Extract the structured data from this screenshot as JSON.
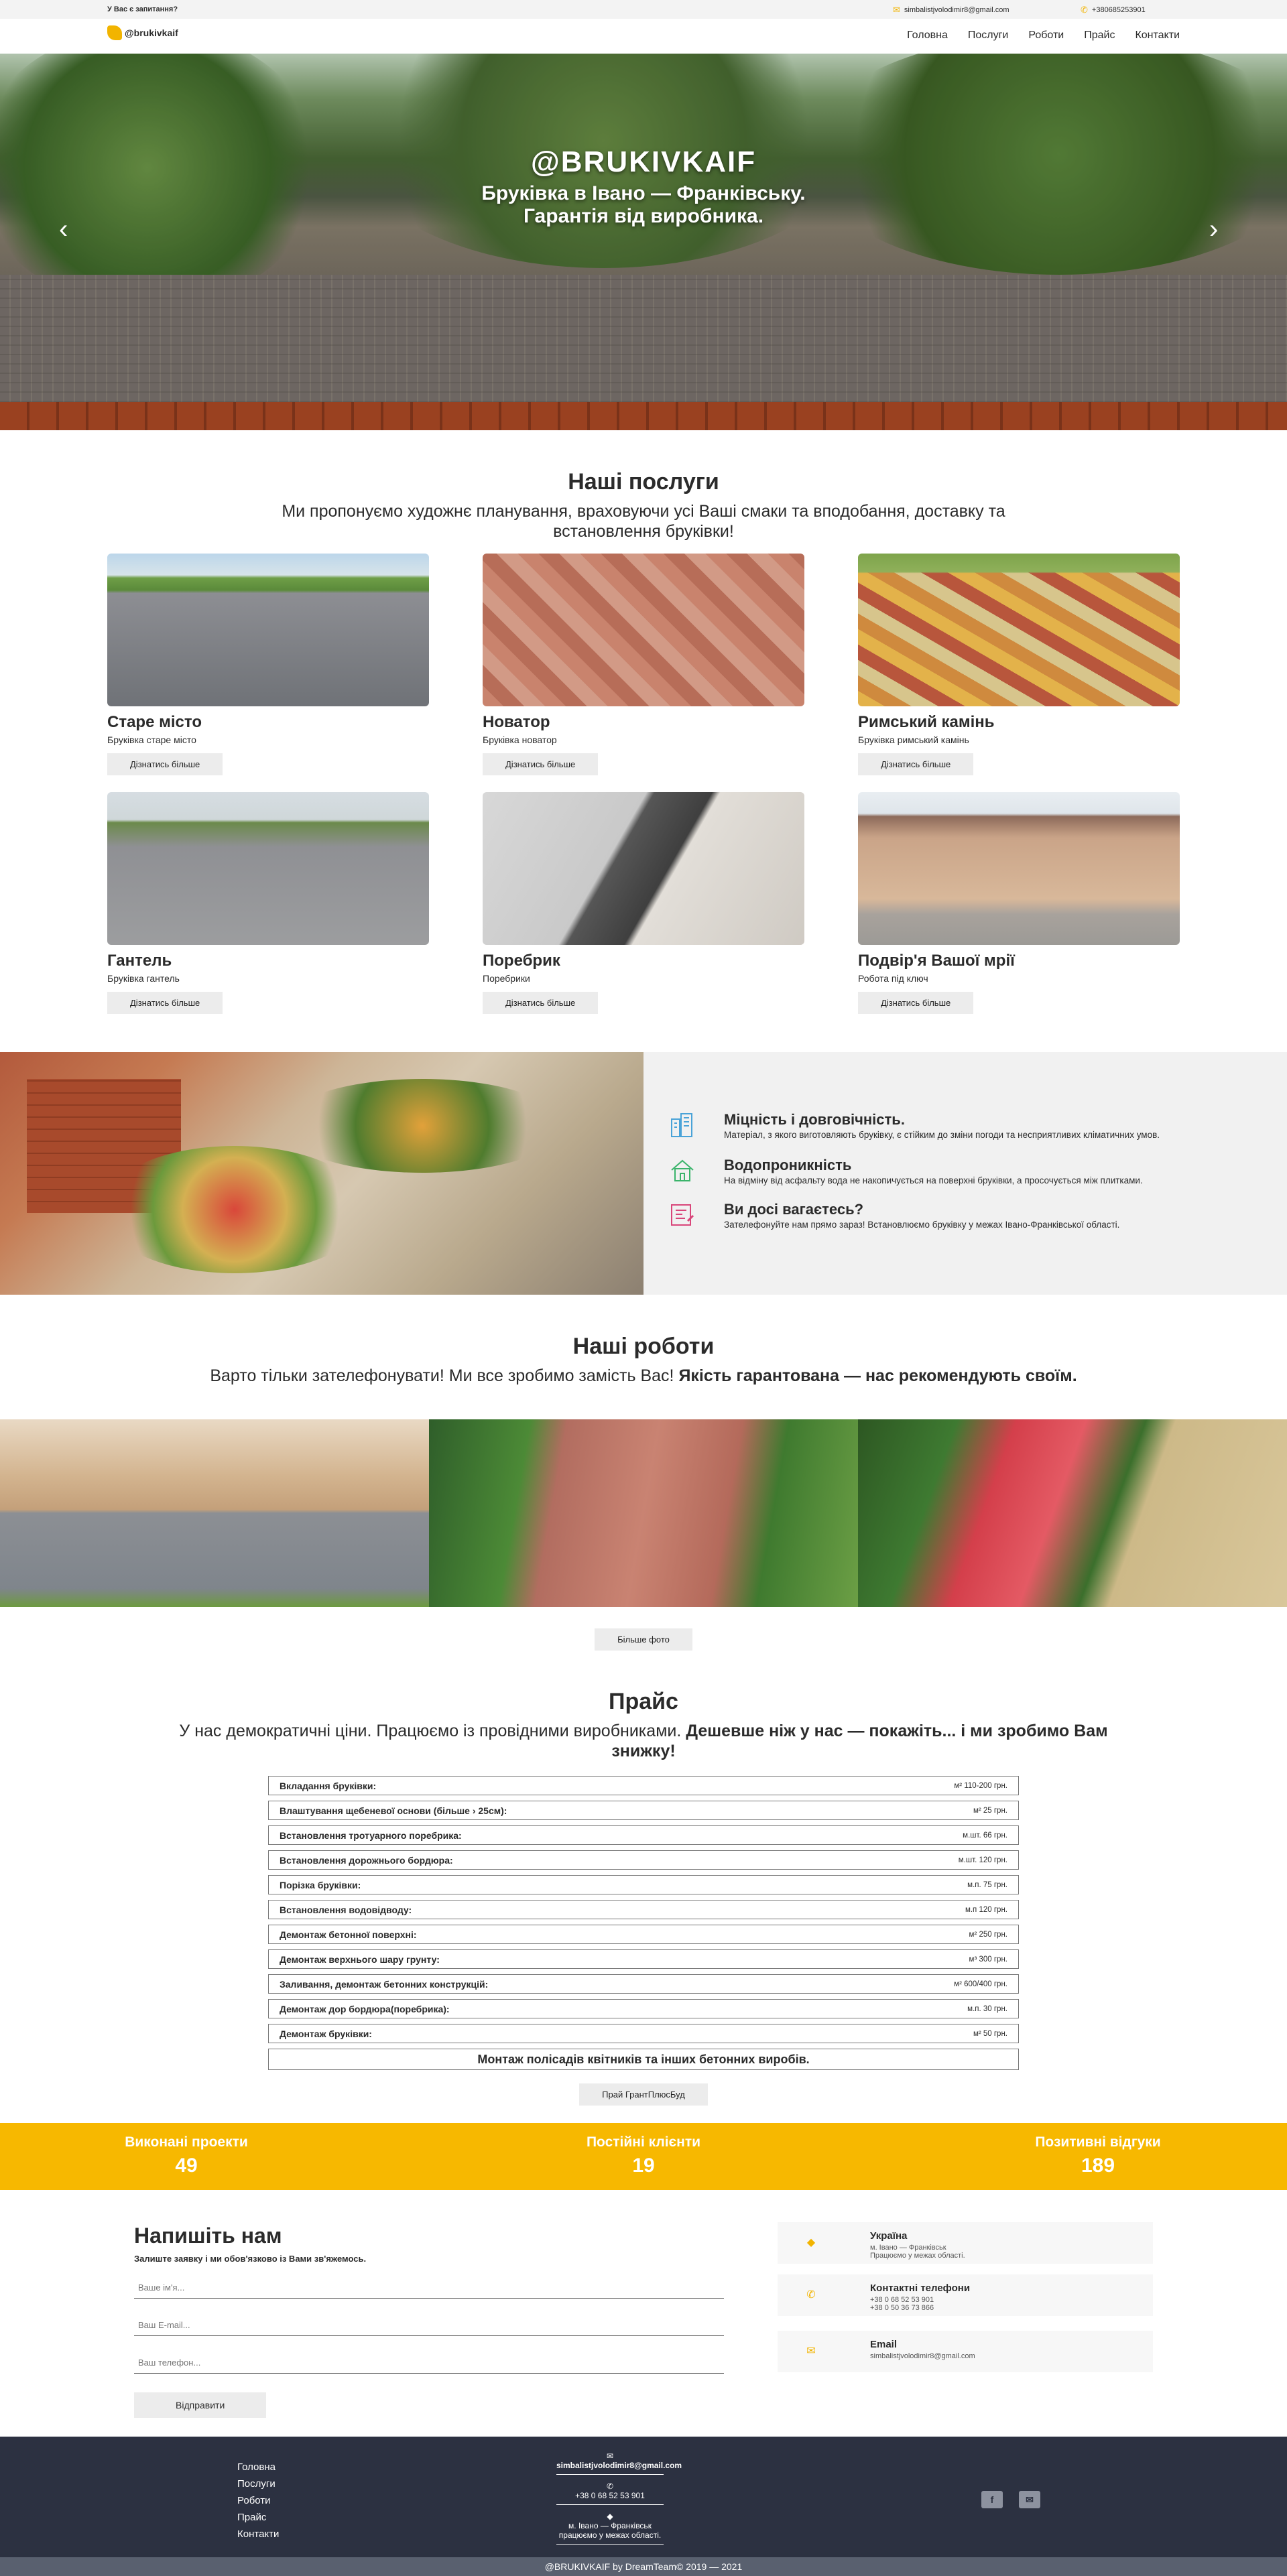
{
  "topbar": {
    "question": "У Вас є запитання?",
    "email": "simbalistjvolodimir8@gmail.com",
    "phone": "+380685253901"
  },
  "header": {
    "logo": "@brukivkaif",
    "nav": [
      "Головна",
      "Послуги",
      "Роботи",
      "Прайс",
      "Контакти"
    ]
  },
  "hero": {
    "title": "@BRUKIVKAIF",
    "subtitle_line1": "Бруківка в Івано — Франківську.",
    "subtitle_line2": "Гарантія від виробника.",
    "prev": "‹",
    "next": "›"
  },
  "services": {
    "title": "Наші послуги",
    "subtitle": "Ми пропонуємо художнє планування, враховуючи усі Ваші смаки та вподобання, доставку та встановлення бруківки!",
    "button": "Дізнатись більше",
    "items": [
      {
        "title": "Старе місто",
        "desc": "Бруківка старе місто"
      },
      {
        "title": "Новатор",
        "desc": "Бруківка новатор"
      },
      {
        "title": "Римський камінь",
        "desc": "Бруківка римський камінь"
      },
      {
        "title": "Гантель",
        "desc": "Бруківка гантель"
      },
      {
        "title": "Поребрик",
        "desc": "Поребрики"
      },
      {
        "title": "Подвір'я Вашої мрії",
        "desc": "Робота під ключ"
      }
    ]
  },
  "features": [
    {
      "icon": "buildings-icon",
      "title": "Міцність і довговічність.",
      "text": "Матеріал, з якого виготовляють бруківку, є стійким до зміни погоди та несприятливих кліматичних умов."
    },
    {
      "icon": "house-icon",
      "title": "Водопроникність",
      "text": "На відміну від асфальту вода не накопичується на поверхні бруківки, а просочується між плитками."
    },
    {
      "icon": "blueprint-icon",
      "title": "Ви досі вагаєтесь?",
      "text": "Зателефонуйте нам прямо зараз! Встановлюємо бруківку у межах Івано-Франківської області."
    }
  ],
  "works": {
    "title": "Наші роботи",
    "subtitle_plain": "Варто тільки зателефонувати! Ми все зробимо замість Вас!",
    "subtitle_bold": "Якість гарантована — нас рекомендують своїм.",
    "button": "Більше фото"
  },
  "price": {
    "title": "Прайс",
    "subtitle_plain": "У нас демократичні ціни. Працюємо із провідними виробниками.",
    "subtitle_bold": "Дешевше ніж у нас — покажіть... і ми зробимо Вам знижку!",
    "rows": [
      {
        "name": "Вкладання бруківки:",
        "value": "м² 110-200 грн."
      },
      {
        "name": "Влаштування щебеневої основи (більше › 25см):",
        "value": "м² 25 грн."
      },
      {
        "name": "Встановлення тротуарного поребрика:",
        "value": "м.шт. 66 грн."
      },
      {
        "name": "Встановлення дорожнього бордюра:",
        "value": "м.шт. 120 грн."
      },
      {
        "name": "Порізка бруківки:",
        "value": "м.п. 75 грн."
      },
      {
        "name": "Встановлення водовідводу:",
        "value": "м.п 120 грн."
      },
      {
        "name": "Демонтаж бетонної поверхні:",
        "value": "м² 250 грн."
      },
      {
        "name": "Демонтаж верхнього шару грунту:",
        "value": "м³ 300 грн."
      },
      {
        "name": "Заливання, демонтаж бетонних конструкцій:",
        "value": "м² 600/400 грн."
      },
      {
        "name": "Демонтаж дор бордюра(поребрика):",
        "value": "м.п. 30 грн."
      },
      {
        "name": "Демонтаж бруківки:",
        "value": "м² 50 грн."
      }
    ],
    "mont": "Монтаж полісадів квітників та інших бетонних виробів.",
    "button": "Прай ГрантПлюсБуд"
  },
  "stats": [
    {
      "label": "Виконані проекти",
      "value": "49"
    },
    {
      "label": "Постійні клієнти",
      "value": "19"
    },
    {
      "label": "Позитивні відгуки",
      "value": "189"
    }
  ],
  "contact": {
    "title": "Напишіть нам",
    "subtitle": "Залиште заявку і ми обов'язково із Вами зв'яжемось.",
    "name_placeholder": "Ваше ім'я...",
    "email_placeholder": "Ваш E-mail...",
    "phone_placeholder": "Ваш телефон...",
    "send": "Відправити",
    "info": [
      {
        "icon": "location-icon",
        "title": "Україна",
        "line1": "м. Івано — Франківськ",
        "line2": "Працюємо у межах області."
      },
      {
        "icon": "phone-icon",
        "title": "Контактні телефони",
        "line1": "+38 0 68 52 53 901",
        "line2": "+38 0 50 36 73 866"
      },
      {
        "icon": "envelope-icon",
        "title": "Email",
        "line1": "simbalistjvolodimir8@gmail.com",
        "line2": ""
      }
    ]
  },
  "footer": {
    "nav": [
      "Головна",
      "Послуги",
      "Роботи",
      "Прайс",
      "Контакти"
    ],
    "email": "simbalistjvolodimir8@gmail.com",
    "phone": "+38 0 68 52 53 901",
    "address_line1": "м. Івано — Франківськ",
    "address_line2": "працюємо у межах області.",
    "facebook": "f",
    "mail": "✉",
    "copyright": "@BRUKIVKAIF by DreamTeam© 2019 — 2021"
  }
}
